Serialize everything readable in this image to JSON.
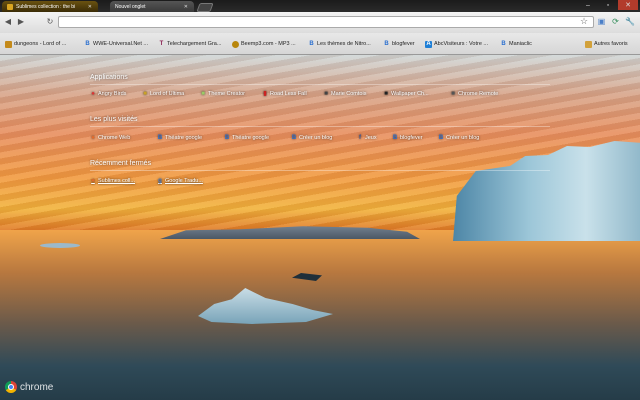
{
  "tabs": [
    {
      "title": "Sublimes collection : the bi"
    },
    {
      "title": "Nouvel onglet"
    }
  ],
  "omnibox": {
    "value": ""
  },
  "bookmarks": [
    {
      "label": "dungeons - Lord of ...",
      "icon": "d",
      "color": "#c48a1a"
    },
    {
      "label": "WWE-Universal.Net ...",
      "icon": "B",
      "color": "#2a6fcf"
    },
    {
      "label": "Telechargement Gra...",
      "icon": "T",
      "color": "#8b2252"
    },
    {
      "label": "Beemp3.com - MP3 ...",
      "icon": "b",
      "color": "#b8860b"
    },
    {
      "label": "Les thèmes de Nitro...",
      "icon": "B",
      "color": "#2a6fcf"
    },
    {
      "label": "blogfever",
      "icon": "B",
      "color": "#2a6fcf"
    },
    {
      "label": "AbcVisiteurs : Votre ...",
      "icon": "A",
      "color": "#1e7fd6"
    },
    {
      "label": "Maniaclic",
      "icon": "B",
      "color": "#2a6fcf"
    },
    {
      "label": "Autres favoris",
      "icon": "folder",
      "color": "#d2a13a"
    }
  ],
  "sections": {
    "apps": {
      "title": "Applications",
      "items": [
        {
          "label": "Angry Birds",
          "color": "#d33"
        },
        {
          "label": "Lord of Ultima",
          "color": "#c9a227"
        },
        {
          "label": "Theme Creator",
          "color": "#9c6"
        },
        {
          "label": "Road Less Fall",
          "color": "#c22"
        },
        {
          "label": "Marie Comtois",
          "color": "#444"
        },
        {
          "label": "Wallpaper Ch...",
          "color": "#222"
        },
        {
          "label": "Chrome Remote",
          "color": "#555"
        }
      ]
    },
    "most_visited": {
      "title": "Les plus visités",
      "items": [
        {
          "label": "Chrome Web",
          "color": "#e56a2a"
        },
        {
          "label": "Théatre google",
          "color": "#2a6fcf"
        },
        {
          "label": "Théatre google",
          "color": "#2a6fcf"
        },
        {
          "label": "Créer un blog",
          "color": "#2a6fcf"
        },
        {
          "label": "Jeux",
          "color": "#3b5998"
        },
        {
          "label": "blogfever",
          "color": "#2a6fcf"
        },
        {
          "label": "Créer un blog",
          "color": "#2a6fcf"
        }
      ]
    },
    "recently_closed": {
      "title": "Récemment fermés",
      "items": [
        {
          "label": "Sublimes coll...",
          "color": "#e56a2a"
        },
        {
          "label": "Google Tradu...",
          "color": "#4a7fc8"
        }
      ]
    }
  },
  "brand": {
    "label": "chrome"
  }
}
